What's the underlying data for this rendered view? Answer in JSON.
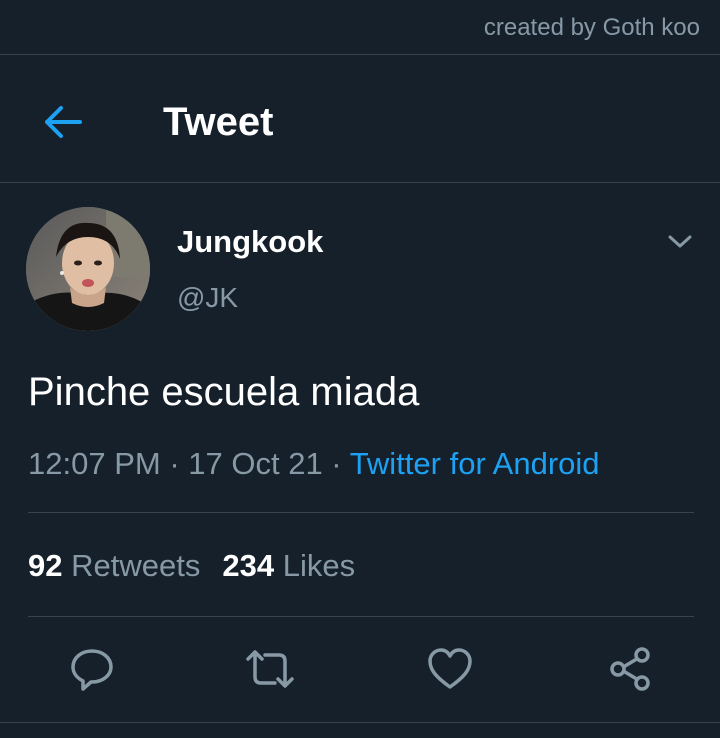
{
  "watermark": "created by Goth koo",
  "header": {
    "title": "Tweet",
    "back_icon": "arrow-left-icon"
  },
  "tweet": {
    "display_name": "Jungkook",
    "handle": "@JK",
    "text": "Pinche escuela miada",
    "time": "12:07 PM",
    "separator": " · ",
    "date": "17 Oct 21",
    "source": "Twitter for Android"
  },
  "stats": {
    "retweets_count": "92",
    "retweets_label": "Retweets",
    "likes_count": "234",
    "likes_label": "Likes"
  },
  "actions": [
    {
      "icon": "reply-icon"
    },
    {
      "icon": "retweet-icon"
    },
    {
      "icon": "like-heart-icon"
    },
    {
      "icon": "share-icon"
    }
  ],
  "colors": {
    "background": "#15202b",
    "divider": "#38444d",
    "secondary_text": "#8899a6",
    "accent": "#1da1f2"
  }
}
